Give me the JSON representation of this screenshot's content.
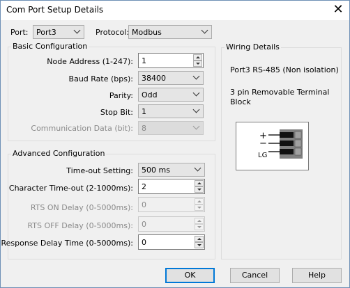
{
  "window": {
    "title": "Com Port Setup Details",
    "close_glyph": "✕"
  },
  "top": {
    "port_label": "Port:",
    "port_value": "Port3",
    "protocol_label": "Protocol:",
    "protocol_value": "Modbus"
  },
  "basic": {
    "title": "Basic Configuration",
    "node_address_label": "Node Address (1-247):",
    "node_address_value": "1",
    "baud_rate_label": "Baud Rate (bps):",
    "baud_rate_value": "38400",
    "parity_label": "Parity:",
    "parity_value": "Odd",
    "stop_bit_label": "Stop Bit:",
    "stop_bit_value": "1",
    "comm_data_label": "Communication Data (bit):",
    "comm_data_value": "8"
  },
  "advanced": {
    "title": "Advanced Configuration",
    "timeout_label": "Time-out Setting:",
    "timeout_value": "500 ms",
    "char_timeout_label": "Character Time-out (2-1000ms):",
    "char_timeout_value": "2",
    "rts_on_label": "RTS ON Delay (0-5000ms):",
    "rts_on_value": "0",
    "rts_off_label": "RTS OFF Delay (0-5000ms):",
    "rts_off_value": "0",
    "response_delay_label": "Response Delay Time (0-5000ms):",
    "response_delay_value": "0"
  },
  "wiring": {
    "title": "Wiring Details",
    "line1": "Port3 RS-485 (Non isolation)",
    "line2": "3 pin Removable Terminal",
    "line3": "Block",
    "pin_plus": "+",
    "pin_minus": "−",
    "pin_lg": "LG"
  },
  "buttons": {
    "ok": "OK",
    "cancel": "Cancel",
    "help": "Help"
  },
  "icons": {
    "close": "close-icon",
    "dropdown": "chevron-down-icon",
    "spin_up": "spin-up-icon",
    "spin_down": "spin-down-icon"
  },
  "colors": {
    "default_button_border": "#0078d7",
    "dialog_background": "#f0f0f0",
    "terminal_block": "#808080"
  }
}
